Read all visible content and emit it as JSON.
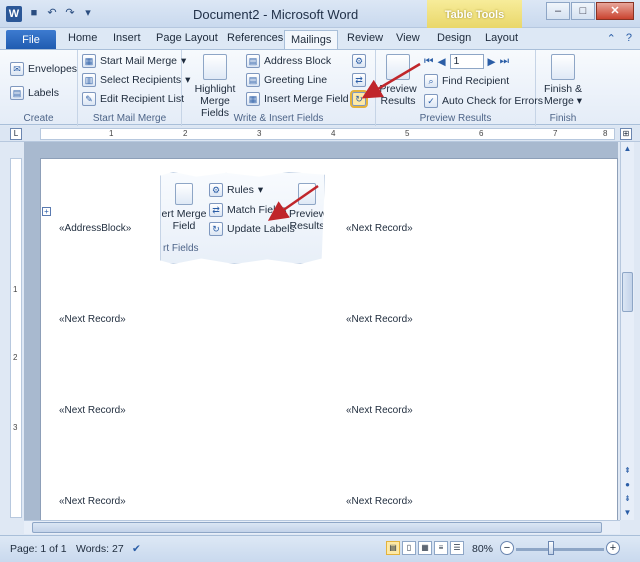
{
  "window": {
    "title": "Document2 - Microsoft Word",
    "context_tab_group": "Table Tools",
    "buttons": [
      "–",
      "□",
      "✕"
    ]
  },
  "tabs": {
    "file": "File",
    "items": [
      "Home",
      "Insert",
      "Page Layout",
      "References",
      "Mailings",
      "Review",
      "View",
      "Design",
      "Layout"
    ],
    "active": "Mailings"
  },
  "ribbon": {
    "create": {
      "label": "Create",
      "envelopes": "Envelopes",
      "labels": "Labels"
    },
    "start": {
      "label": "Start Mail Merge",
      "start_mail_merge": "Start Mail Merge",
      "select_recipients": "Select Recipients",
      "edit_recipient_list": "Edit Recipient List"
    },
    "write": {
      "label": "Write & Insert Fields",
      "highlight_line1": "Highlight",
      "highlight_line2": "Merge Fields",
      "address_block": "Address Block",
      "greeting_line": "Greeting Line",
      "insert_merge_field": "Insert Merge Field"
    },
    "preview": {
      "label": "Preview Results",
      "preview_line1": "Preview",
      "preview_line2": "Results",
      "record": "1",
      "find_recipient": "Find Recipient",
      "auto_check": "Auto Check for Errors"
    },
    "finish": {
      "label": "Finish",
      "finish_line1": "Finish &",
      "finish_line2": "Merge"
    }
  },
  "inset": {
    "rules": "Rules",
    "match_fields": "Match Fields",
    "update_labels": "Update Labels",
    "insert_merge_line1": "ert Merge",
    "insert_merge_line2": "Field",
    "group_label": "rt Fields",
    "preview_line1": "Preview",
    "preview_line2": "Results"
  },
  "document": {
    "fields": [
      "«AddressBlock»",
      "«Next Record»",
      "«Next Record»",
      "«Next Record»",
      "«Next Record»",
      "«Next Record»",
      "«Next Record»",
      "«Next Record»"
    ]
  },
  "ruler": {
    "h_ticks": [
      "1",
      "2",
      "3",
      "4",
      "5",
      "6",
      "7",
      "8"
    ],
    "v_ticks": [
      "1",
      "2",
      "3"
    ],
    "tab_selector": "L"
  },
  "statusbar": {
    "page": "Page: 1 of 1",
    "words": "Words: 27",
    "zoom": "80%"
  },
  "colors": {
    "accent": "#2b5797",
    "arrow": "#c0262b",
    "table_tools": "#e9d76a"
  }
}
